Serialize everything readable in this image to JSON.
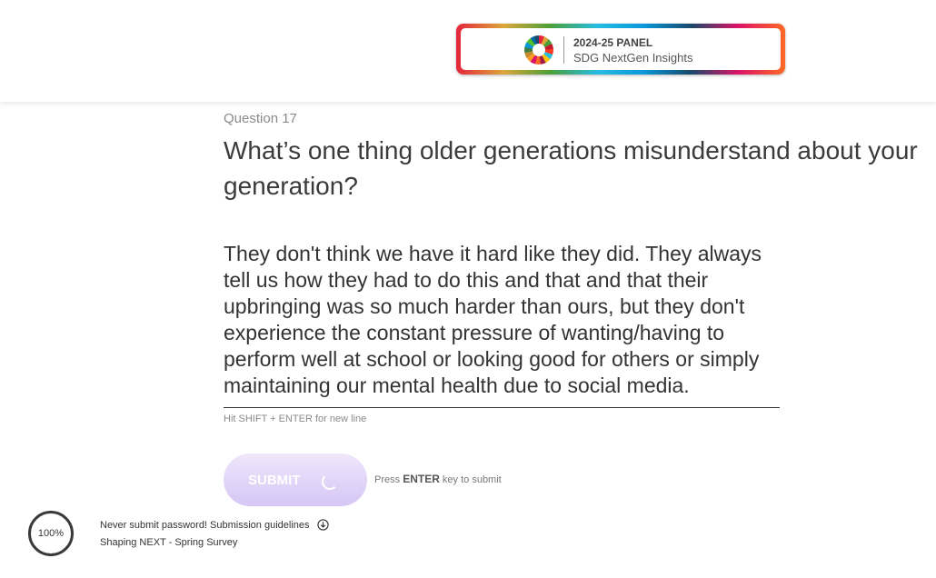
{
  "banner": {
    "line1_year": "2024-25",
    "line1_panel": "PANEL",
    "line2": "SDG NextGen Insights"
  },
  "question": {
    "number_label": "Question 17",
    "title": "What’s one thing older generations misunderstand about your generation?"
  },
  "answer": {
    "value": "They don't think we have it hard like they did. They always tell us how they had to do this and that and that their upbringing was so much harder than ours, but they don't experience the constant pressure of wanting/having to perform well at school or looking good for others or simply maintaining our mental health due to social media."
  },
  "hint": "Hit SHIFT + ENTER for new line",
  "submit": {
    "label": "SUBMIT",
    "press_prefix": "Press",
    "press_key": "ENTER",
    "press_suffix": "key to submit"
  },
  "footer": {
    "progress": "100%",
    "password_notice": "Never submit password! Submission guidelines",
    "survey_name": "Shaping NEXT - Spring Survey"
  }
}
